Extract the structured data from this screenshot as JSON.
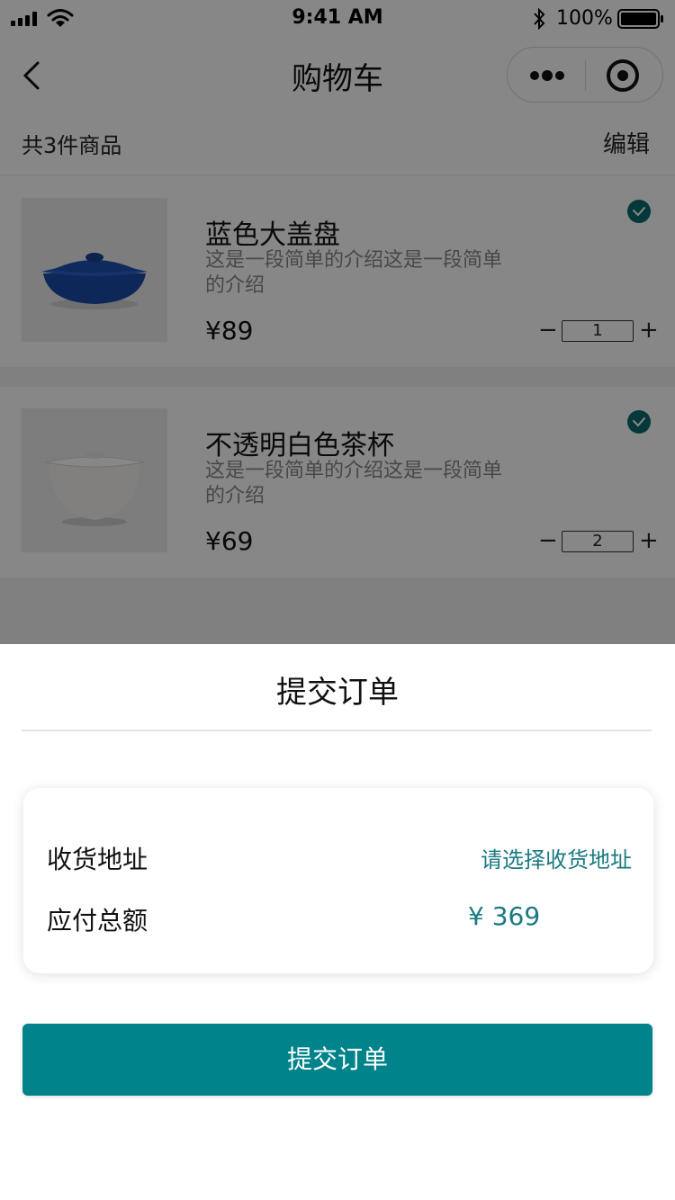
{
  "status_bar": {
    "time": "9:41 AM",
    "battery_text": "100%"
  },
  "nav": {
    "title": "购物车"
  },
  "cart": {
    "count_text": "共3件商品",
    "edit_label": "编辑",
    "items": [
      {
        "name": "蓝色大盖盘",
        "desc": "这是一段简单的介绍这是一段简单的介绍",
        "price": "¥89",
        "qty": "1",
        "checked": true,
        "image": "blue-lidded-pot"
      },
      {
        "name": "不透明白色茶杯",
        "desc": "这是一段简单的介绍这是一段简单的介绍",
        "price": "¥69",
        "qty": "2",
        "checked": true,
        "image": "white-tea-cup"
      }
    ],
    "minus_symbol": "−",
    "plus_symbol": "+"
  },
  "sheet": {
    "title": "提交订单",
    "address_label": "收货地址",
    "address_action": "请选择收货地址",
    "total_label": "应付总额",
    "total_value": "¥ 369",
    "submit_label": "提交订单"
  },
  "colors": {
    "accent": "#00838a",
    "accent_text": "#1a7a80",
    "check": "#0b6b70"
  }
}
